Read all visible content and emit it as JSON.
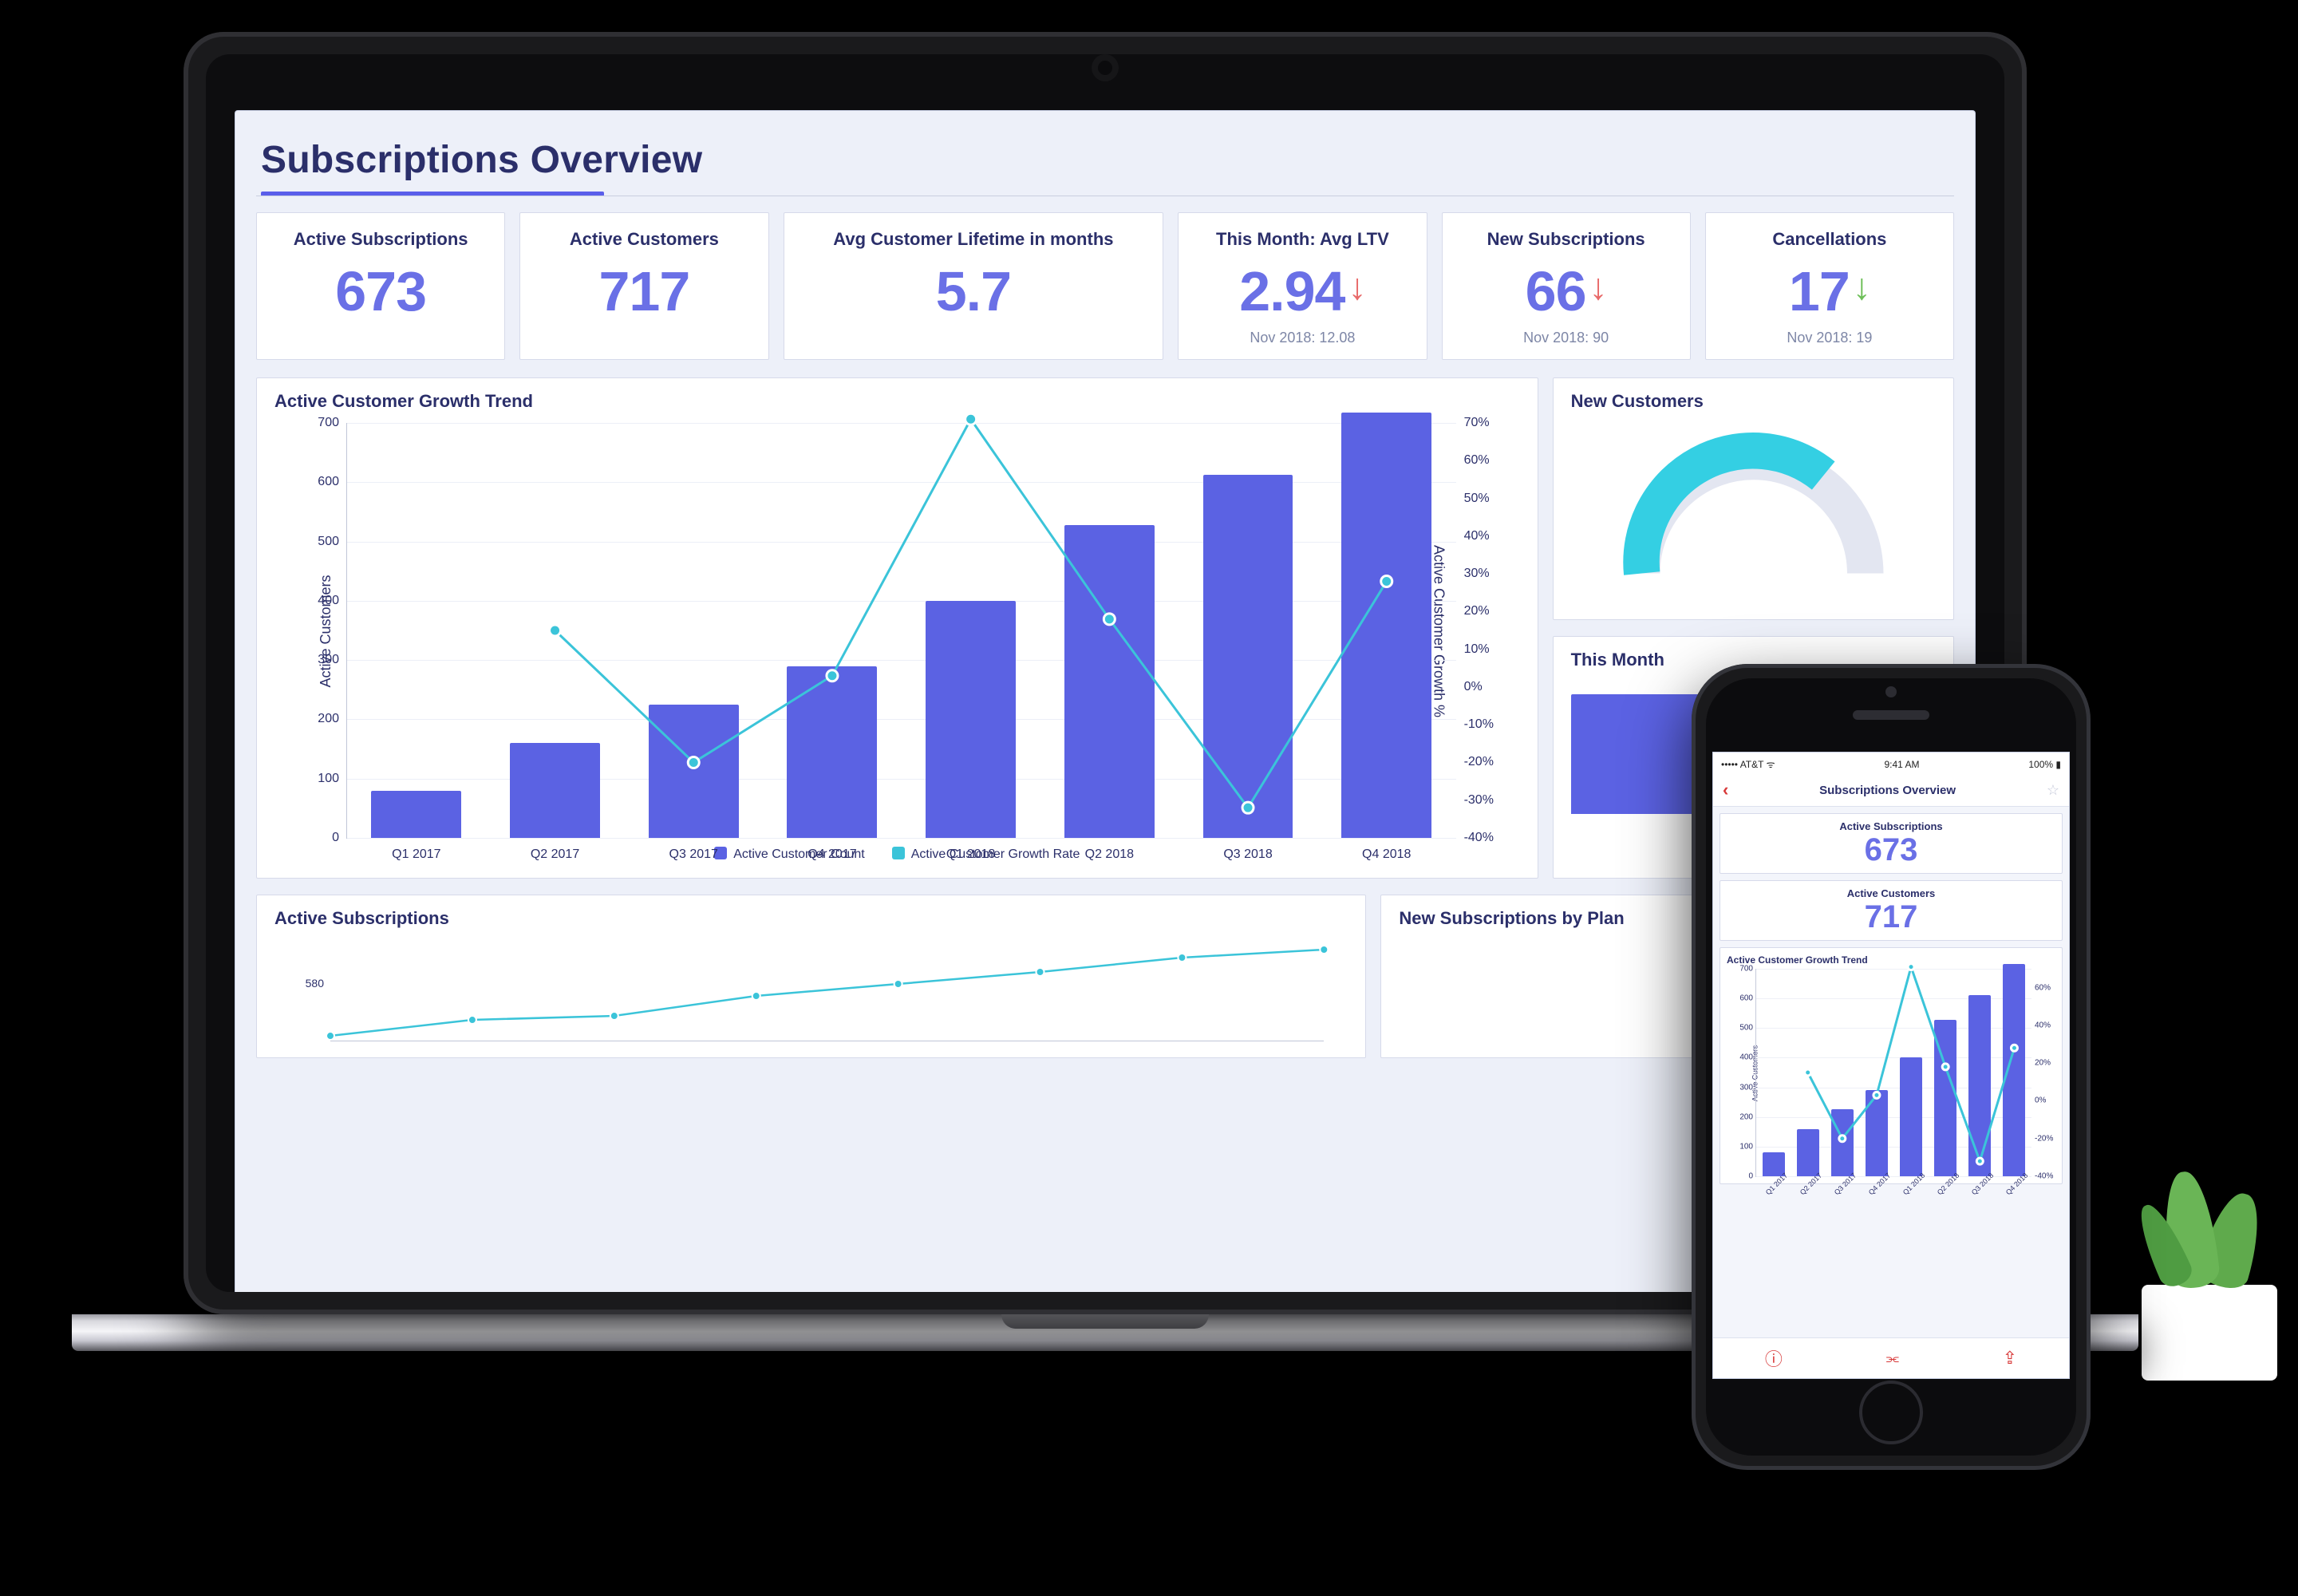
{
  "page": {
    "title": "Subscriptions Overview"
  },
  "kpis": [
    {
      "label": "Active Subscriptions",
      "value": "673",
      "trend": "",
      "sub": ""
    },
    {
      "label": "Active Customers",
      "value": "717",
      "trend": "",
      "sub": ""
    },
    {
      "label": "Avg Customer Lifetime in months",
      "value": "5.7",
      "trend": "",
      "sub": ""
    },
    {
      "label": "This Month: Avg LTV",
      "value": "2.94",
      "trend": "down",
      "sub": "Nov 2018: 12.08"
    },
    {
      "label": "New Subscriptions",
      "value": "66",
      "trend": "down",
      "sub": "Nov 2018: 90"
    },
    {
      "label": "Cancellations",
      "value": "17",
      "trend": "up",
      "sub": "Nov 2018: 19"
    }
  ],
  "panels": {
    "growth": {
      "title": "Active Customer Growth Trend"
    },
    "newcust": {
      "title": "New Customers"
    },
    "thismonth": {
      "title": "This Month"
    },
    "subs": {
      "title": "Active Subscriptions"
    },
    "byplan": {
      "title": "New Subscriptions by Plan"
    }
  },
  "legend": {
    "bars": "Active Customer Count",
    "line": "Active Customer Growth Rate"
  },
  "axis": {
    "left": "Active Customers",
    "right": "Active Customer Growth %"
  },
  "phone": {
    "status": {
      "carrier": "AT&T",
      "time": "9:41 AM",
      "battery": "100%"
    },
    "title": "Subscriptions Overview",
    "cards": [
      {
        "label": "Active Subscriptions",
        "value": "673"
      },
      {
        "label": "Active Customers",
        "value": "717"
      }
    ],
    "axisLeft": "Active Customers",
    "axisRight": "Active Customer Growth %"
  },
  "chart_data": {
    "type": "bar+line",
    "title": "Active Customer Growth Trend",
    "categories": [
      "Q1 2017",
      "Q2 2017",
      "Q3 2017",
      "Q4 2017",
      "Q1 2018",
      "Q2 2018",
      "Q3 2018",
      "Q4 2018"
    ],
    "series": [
      {
        "name": "Active Customer Count",
        "kind": "bar",
        "axis": "left",
        "values": [
          80,
          160,
          225,
          290,
          400,
          528,
          612,
          717
        ]
      },
      {
        "name": "Active Customer Growth Rate",
        "kind": "line",
        "axis": "right",
        "values": [
          null,
          15,
          -20,
          3,
          71,
          18,
          -32,
          28
        ]
      }
    ],
    "y_left": {
      "label": "Active Customers",
      "min": 0,
      "max": 700,
      "step": 100
    },
    "y_right": {
      "label": "Active Customer Growth %",
      "min": -40,
      "max": 70,
      "step": 10,
      "unit": "%"
    },
    "legend": [
      "Active Customer Count",
      "Active Customer Growth Rate"
    ]
  },
  "subs_thumb": {
    "type": "line",
    "y_tick": "580",
    "points": [
      480,
      500,
      505,
      530,
      545,
      560,
      578,
      588
    ]
  }
}
